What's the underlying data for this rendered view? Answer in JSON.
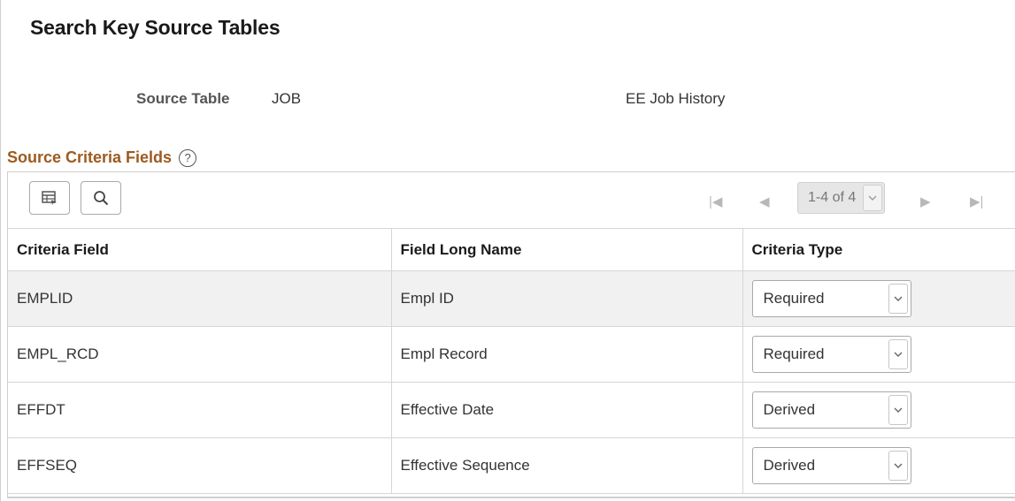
{
  "page": {
    "title": "Search Key Source Tables"
  },
  "source": {
    "label": "Source Table",
    "table": "JOB",
    "description": "EE Job History"
  },
  "section": {
    "title": "Source Criteria Fields",
    "help_icon": "question-circle-icon"
  },
  "toolbar": {
    "personalize_icon": "grid-personalize-icon",
    "find_icon": "search-icon"
  },
  "pager": {
    "first_icon": "first-page-icon",
    "prev_icon": "previous-page-icon",
    "range": "1-4 of 4",
    "next_icon": "next-page-icon",
    "last_icon": "last-page-icon"
  },
  "table": {
    "headers": [
      "Criteria Field",
      "Field Long Name",
      "Criteria Type"
    ],
    "rows": [
      {
        "field": "EMPLID",
        "long_name": "Empl ID",
        "type": "Required"
      },
      {
        "field": "EMPL_RCD",
        "long_name": "Empl Record",
        "type": "Required"
      },
      {
        "field": "EFFDT",
        "long_name": "Effective Date",
        "type": "Derived"
      },
      {
        "field": "EFFSEQ",
        "long_name": "Effective Sequence",
        "type": "Derived"
      }
    ]
  },
  "colors": {
    "section_title": "#9e5a1f",
    "row_alt": "#f1f1f1",
    "border": "#d6d6d6"
  }
}
